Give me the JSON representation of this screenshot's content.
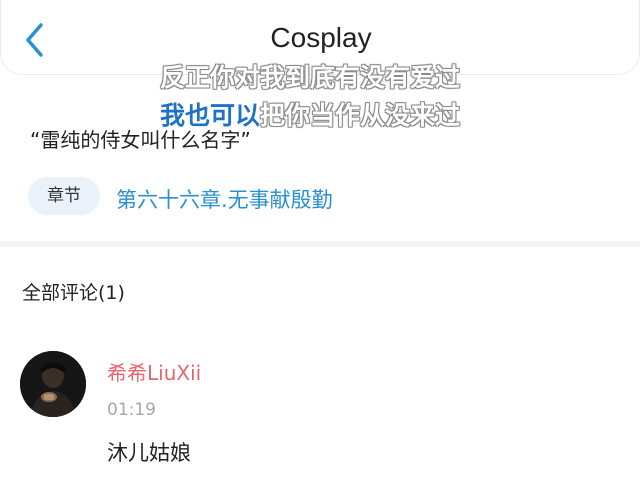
{
  "header": {
    "title": "Cosplay",
    "back_icon": "chevron-left-icon"
  },
  "lyrics": {
    "line1": "反正你对我到底有没有爱过",
    "line2_highlight": "我也可以",
    "line2_rest": "把你当作从没来过"
  },
  "question": {
    "text": "“雷纯的侍女叫什么名字”"
  },
  "chapter": {
    "tag_label": "章节",
    "link": "第六十六章.无事献殷勤"
  },
  "comments": {
    "header": "全部评论(1)",
    "items": [
      {
        "username": "希希LiuXii",
        "time": "01:19",
        "text": "沐儿姑娘",
        "avatar_icon": "user-avatar"
      }
    ]
  },
  "colors": {
    "accent": "#2a8fd0",
    "username": "#e8646e",
    "tag_bg": "#e9f2fb",
    "muted": "#a8a8a8"
  }
}
